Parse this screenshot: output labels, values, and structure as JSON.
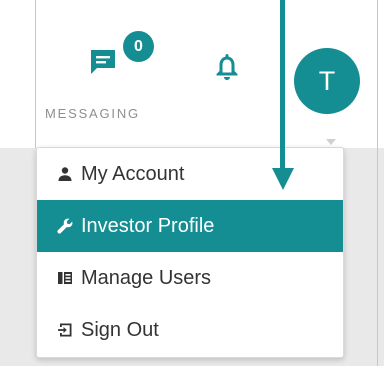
{
  "header": {
    "messaging": {
      "label": "MESSAGING",
      "badge_count": "0",
      "icon": "chat-lines-icon"
    },
    "notifications": {
      "icon": "bell-icon"
    },
    "avatar": {
      "initial": "T"
    }
  },
  "user_menu": {
    "items": [
      {
        "label": "My Account",
        "icon": "person-icon",
        "active": false
      },
      {
        "label": "Investor Profile",
        "icon": "wrench-icon",
        "active": true
      },
      {
        "label": "Manage Users",
        "icon": "users-list-icon",
        "active": false
      },
      {
        "label": "Sign Out",
        "icon": "sign-out-icon",
        "active": false
      }
    ]
  },
  "annotation": {
    "icon": "pointer-arrow-icon"
  },
  "colors": {
    "accent": "#148e92",
    "text": "#333333",
    "muted_text": "#8f8f8f",
    "background_shade": "#e9e9e9"
  }
}
